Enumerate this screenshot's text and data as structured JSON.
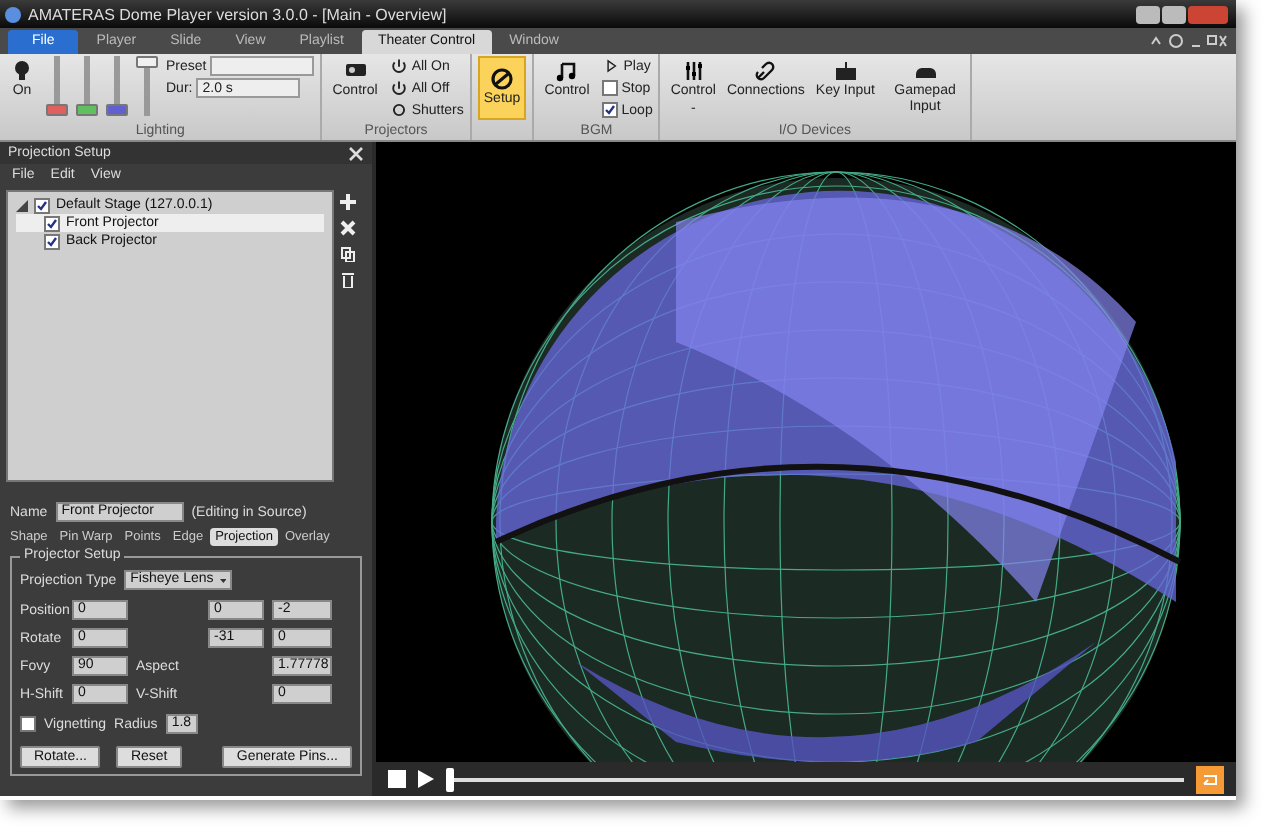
{
  "window": {
    "title": "AMATERAS Dome Player version 3.0.0 - [Main - Overview]"
  },
  "tabs": [
    {
      "label": "File",
      "kind": "file",
      "selected": false
    },
    {
      "label": "Player",
      "kind": "tab",
      "selected": false
    },
    {
      "label": "Slide",
      "kind": "tab",
      "selected": false
    },
    {
      "label": "View",
      "kind": "tab",
      "selected": false
    },
    {
      "label": "Playlist",
      "kind": "tab",
      "selected": false
    },
    {
      "label": "Theater Control",
      "kind": "tab",
      "selected": true
    },
    {
      "label": "Window",
      "kind": "tab",
      "selected": false
    }
  ],
  "ribbon": {
    "lighting": {
      "label": "Lighting",
      "on_button": "On",
      "sliders": [
        {
          "color": "#e06060",
          "level": 0
        },
        {
          "color": "#60c060",
          "level": 0
        },
        {
          "color": "#6060d0",
          "level": 0
        },
        {
          "color": "#f0f0f0",
          "level": 1
        }
      ],
      "preset_label": "Preset",
      "duration_label": "Dur:",
      "duration": "2.0 s"
    },
    "projectors": {
      "label": "Projectors",
      "control": "Control",
      "items": [
        "All On",
        "All Off",
        "Shutters"
      ]
    },
    "setup": {
      "label": "Setup",
      "selected": true
    },
    "bgm": {
      "label": "BGM",
      "control": "Control",
      "play": "Play",
      "stop": {
        "label": "Stop",
        "checked": false
      },
      "loop": {
        "label": "Loop",
        "checked": true
      }
    },
    "io_devices": {
      "label": "I/O Devices",
      "control": "Control",
      "caret": "-",
      "items": [
        "Connections",
        "Key Input",
        "Gamepad Input"
      ]
    }
  },
  "panel": {
    "title": "Projection Setup",
    "menu": [
      "File",
      "Edit",
      "View"
    ],
    "tree": [
      {
        "label": "Default Stage (127.0.0.1)",
        "checked": true,
        "expanded": true,
        "selected": false,
        "children": [
          {
            "label": "Front Projector",
            "checked": true,
            "selected": true
          },
          {
            "label": "Back Projector",
            "checked": true,
            "selected": false
          }
        ]
      }
    ],
    "name_label": "Name",
    "name_value": "Front Projector",
    "name_note": "(Editing in Source)",
    "tabs": [
      {
        "label": "Shape",
        "selected": false
      },
      {
        "label": "Pin Warp",
        "selected": false
      },
      {
        "label": "Points",
        "selected": false
      },
      {
        "label": "Edge",
        "selected": false
      },
      {
        "label": "Projection",
        "selected": true
      },
      {
        "label": "Overlay",
        "selected": false
      }
    ],
    "group_title": "Projector Setup",
    "projection_type_label": "Projection Type",
    "projection_type": "Fisheye Lens",
    "rows": [
      {
        "label": "Position",
        "values": [
          "0",
          "0",
          "-2"
        ]
      },
      {
        "label": "Rotate",
        "values": [
          "0",
          "-31",
          "0"
        ]
      }
    ],
    "fovy_label": "Fovy",
    "fovy": "90",
    "aspect_label": "Aspect",
    "aspect": "1.77778",
    "hshift_label": "H-Shift",
    "hshift": "0",
    "vshift_label": "V-Shift",
    "vshift": "0",
    "vignetting": {
      "label": "Vignetting",
      "checked": false
    },
    "radius_label": "Radius",
    "radius": "1.8",
    "buttons": [
      "Rotate...",
      "Reset",
      "Generate Pins..."
    ]
  },
  "player": {
    "seek": {
      "level": 0
    }
  }
}
